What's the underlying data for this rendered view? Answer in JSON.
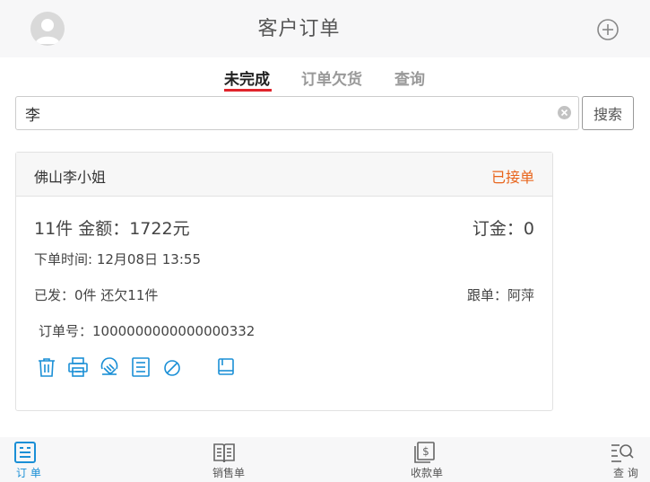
{
  "header": {
    "title": "客户订单",
    "avatar_icon": "user-avatar-icon",
    "add_icon": "plus-circle-icon"
  },
  "tabs": [
    {
      "label": "未完成",
      "active": true
    },
    {
      "label": "订单欠货",
      "active": false
    },
    {
      "label": "查询",
      "active": false
    }
  ],
  "search": {
    "value": "李",
    "button_label": "搜索"
  },
  "order": {
    "customer": "佛山李小姐",
    "status": "已接单",
    "quantity_amount": "11件 金额：1722元",
    "deposit": "订金：0",
    "order_time": "下单时间: 12月08日 13:55",
    "shipped_owed": "已发：0件 还欠11件",
    "follower": "跟单：阿萍",
    "order_number": "订单号：1000000000000000332"
  },
  "action_icons": [
    "trash-icon",
    "printer-icon",
    "handshake-icon",
    "list-icon",
    "cancel-icon",
    "book-icon"
  ],
  "tabbar": [
    {
      "label": "订 单",
      "icon": "order-icon",
      "active": true
    },
    {
      "label": "销售单",
      "icon": "sales-book-icon",
      "active": false
    },
    {
      "label": "收款单",
      "icon": "receipt-icon",
      "active": false
    },
    {
      "label": "查 询",
      "icon": "search-list-icon",
      "active": false
    }
  ],
  "colors": {
    "accent": "#1a8fd6",
    "tab_underline": "#e0242c",
    "status": "#e8641b"
  }
}
